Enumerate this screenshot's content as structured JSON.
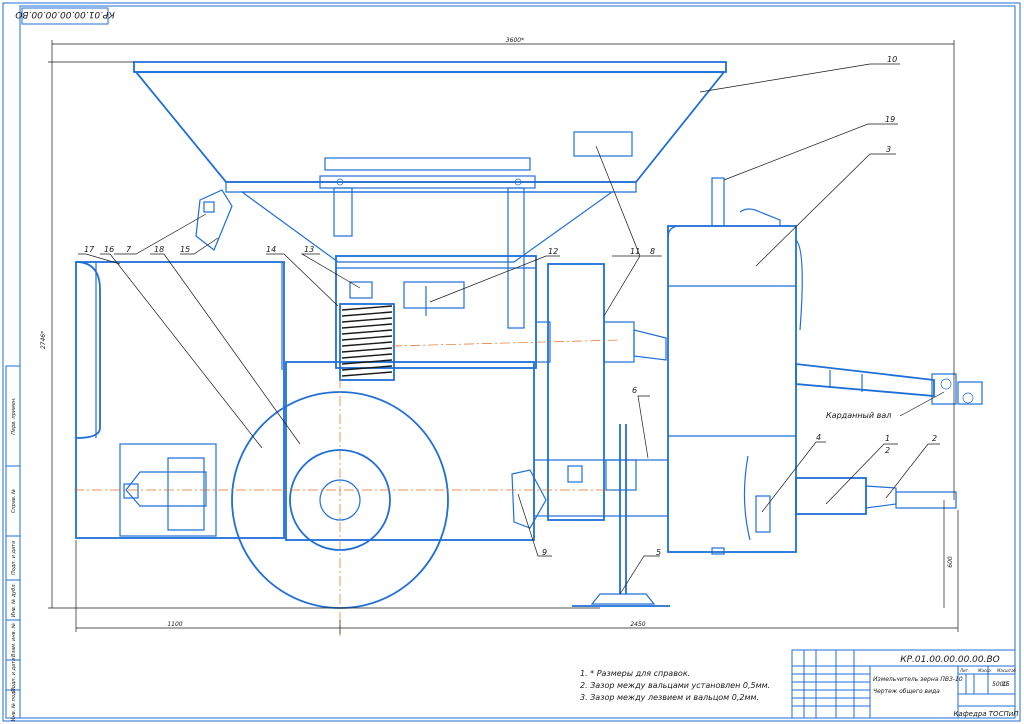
{
  "drawing": {
    "stamp_top": "КР.01.00.00.00.00.ВО",
    "designation": "КР.01.00.00.00.00.ВО",
    "title_line1": "Измельчитель зерна ПВЗ-10",
    "title_line2": "Чертеж общего вида",
    "scale": "1:8",
    "mass": "5000",
    "sheet": "15",
    "department": "Кафедра ТОСПиП",
    "label_litera": "Лит.",
    "label_mass": "Масса",
    "label_scale": "Масштаб"
  },
  "dimensions": {
    "overall_length": "3600*",
    "height": "2746*",
    "left_part": "1100",
    "right_part": "2450",
    "clearance": "600"
  },
  "callouts": [
    "1",
    "2",
    "3",
    "4",
    "5",
    "6",
    "7",
    "8",
    "9",
    "10",
    "11",
    "12",
    "13",
    "14",
    "15",
    "16",
    "17",
    "18",
    "19"
  ],
  "callout_sub": "2",
  "cardan_label": "Карданный вал",
  "notes": [
    "1. * Размеры для справок.",
    "2. Зазор между вальцами установлен 0,5мм.",
    "3. Зазор между лезвием и вальцом 0,2мм."
  ],
  "side_labels": [
    "Перв. примен.",
    "Справ. №",
    "Подп. и дата",
    "Инв. № дубл.",
    "Взам. инв. №",
    "Подп. и дата",
    "Инв. № подл."
  ],
  "colors": {
    "outline": "#1f6fd8",
    "annotation": "#1a1a1a",
    "axis": "#e07020"
  }
}
